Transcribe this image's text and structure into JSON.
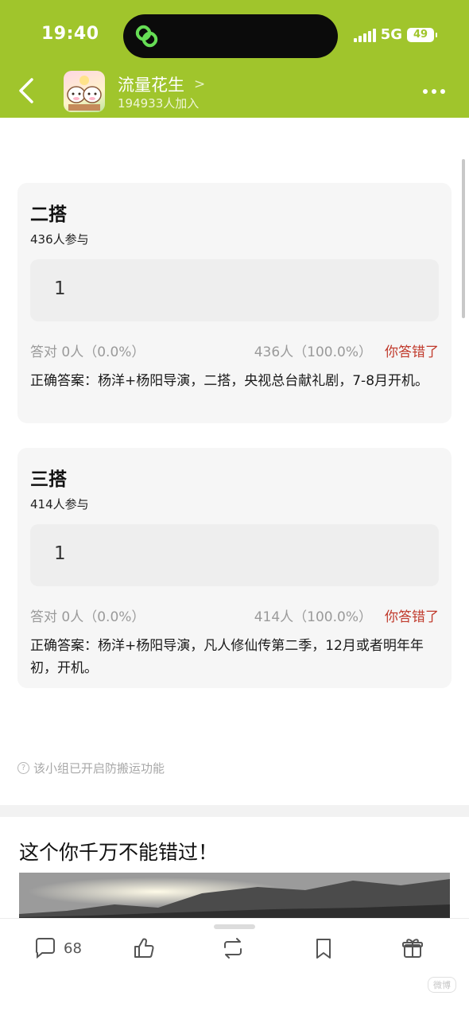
{
  "status_bar": {
    "time": "19:40",
    "network": "5G",
    "battery": "49"
  },
  "header": {
    "group_name": "流量花生",
    "member_count": "194933人加入"
  },
  "quizzes": [
    {
      "title": "二搭",
      "participants": "436人参与",
      "option": "1",
      "correct_stat": "答对  0人（0.0%）",
      "wrong_stat": "436人（100.0%）",
      "wrong_label": "你答错了",
      "answer": "正确答案：杨洋+杨阳导演，二搭，央视总台献礼剧，7-8月开机。"
    },
    {
      "title": "三搭",
      "participants": "414人参与",
      "option": "1",
      "correct_stat": "答对  0人（0.0%）",
      "wrong_stat": "414人（100.0%）",
      "wrong_label": "你答错了",
      "answer": "正确答案：杨洋+杨阳导演，凡人修仙传第二季，12月或者明年年初，开机。"
    }
  ],
  "notice": "该小组已开启防搬运功能",
  "recommendation": {
    "title": "这个你千万不能错过！"
  },
  "bottom_bar": {
    "comment_count": "68",
    "watermark": "微博"
  },
  "colors": {
    "brand_green": "#a0c52c",
    "wrong_red": "#c0392b"
  }
}
